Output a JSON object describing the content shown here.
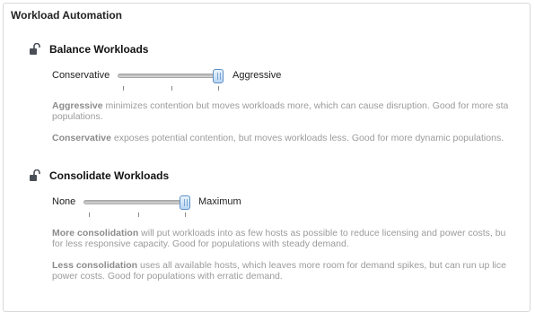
{
  "panel": {
    "title": "Workload Automation"
  },
  "balance": {
    "title": "Balance Workloads",
    "min_label": "Conservative",
    "max_label": "Aggressive",
    "slider_value": 1.0,
    "desc1": {
      "term": "Aggressive",
      "line1": " minimizes contention but moves workloads more, which can cause disruption. Good for more sta",
      "line2": "populations."
    },
    "desc2": {
      "term": "Conservative",
      "line1": " exposes potential contention, but moves workloads less. Good for more dynamic populations."
    }
  },
  "consolidate": {
    "title": "Consolidate Workloads",
    "min_label": "None",
    "max_label": "Maximum",
    "slider_value": 1.0,
    "desc1": {
      "term": "More consolidation",
      "line1": " will put workloads into as few hosts as possible to reduce licensing and power costs, bu",
      "line2": "for less responsive capacity. Good for populations with steady demand."
    },
    "desc2": {
      "term": "Less consolidation",
      "line1": " uses all available hosts, which leaves more room for demand spikes, but can run up lice",
      "line2": "power costs. Good for populations with erratic demand."
    }
  },
  "colors": {
    "accent": "#5b8fc6",
    "muted_text": "#9b9b9b",
    "border": "#d9d9d9"
  },
  "icons": {
    "lock": "unlocked-padlock-icon"
  }
}
